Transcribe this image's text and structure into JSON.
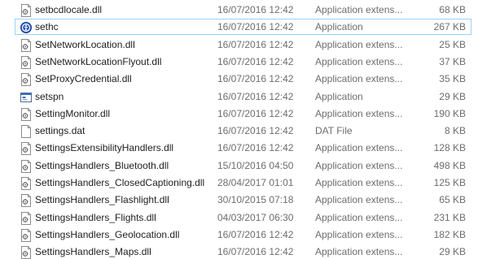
{
  "files": [
    {
      "name": "setbcdlocale.dll",
      "date": "16/07/2016 12:42",
      "type": "Application extens...",
      "size": "68 KB",
      "icon": "dll-file-icon"
    },
    {
      "name": "sethc",
      "date": "16/07/2016 12:42",
      "type": "Application",
      "size": "267 KB",
      "icon": "accessibility-app-icon",
      "selected": true
    },
    {
      "name": "SetNetworkLocation.dll",
      "date": "16/07/2016 12:42",
      "type": "Application extens...",
      "size": "25 KB",
      "icon": "dll-file-icon"
    },
    {
      "name": "SetNetworkLocationFlyout.dll",
      "date": "16/07/2016 12:42",
      "type": "Application extens...",
      "size": "37 KB",
      "icon": "dll-file-icon"
    },
    {
      "name": "SetProxyCredential.dll",
      "date": "16/07/2016 12:42",
      "type": "Application extens...",
      "size": "35 KB",
      "icon": "dll-file-icon"
    },
    {
      "name": "setspn",
      "date": "16/07/2016 12:42",
      "type": "Application",
      "size": "29 KB",
      "icon": "console-app-icon"
    },
    {
      "name": "SettingMonitor.dll",
      "date": "16/07/2016 12:42",
      "type": "Application extens...",
      "size": "190 KB",
      "icon": "dll-file-icon"
    },
    {
      "name": "settings.dat",
      "date": "16/07/2016 12:42",
      "type": "DAT File",
      "size": "8 KB",
      "icon": "blank-file-icon"
    },
    {
      "name": "SettingsExtensibilityHandlers.dll",
      "date": "16/07/2016 12:42",
      "type": "Application extens...",
      "size": "128 KB",
      "icon": "dll-file-icon"
    },
    {
      "name": "SettingsHandlers_Bluetooth.dll",
      "date": "15/10/2016 04:50",
      "type": "Application extens...",
      "size": "498 KB",
      "icon": "dll-file-icon"
    },
    {
      "name": "SettingsHandlers_ClosedCaptioning.dll",
      "date": "28/04/2017 01:01",
      "type": "Application extens...",
      "size": "125 KB",
      "icon": "dll-file-icon"
    },
    {
      "name": "SettingsHandlers_Flashlight.dll",
      "date": "30/10/2015 07:18",
      "type": "Application extens...",
      "size": "65 KB",
      "icon": "dll-file-icon"
    },
    {
      "name": "SettingsHandlers_Flights.dll",
      "date": "04/03/2017 06:30",
      "type": "Application extens...",
      "size": "231 KB",
      "icon": "dll-file-icon"
    },
    {
      "name": "SettingsHandlers_Geolocation.dll",
      "date": "16/07/2016 12:42",
      "type": "Application extens...",
      "size": "182 KB",
      "icon": "dll-file-icon"
    },
    {
      "name": "SettingsHandlers_Maps.dll",
      "date": "16/07/2016 12:42",
      "type": "Application extens...",
      "size": "29 KB",
      "icon": "dll-file-icon"
    }
  ]
}
